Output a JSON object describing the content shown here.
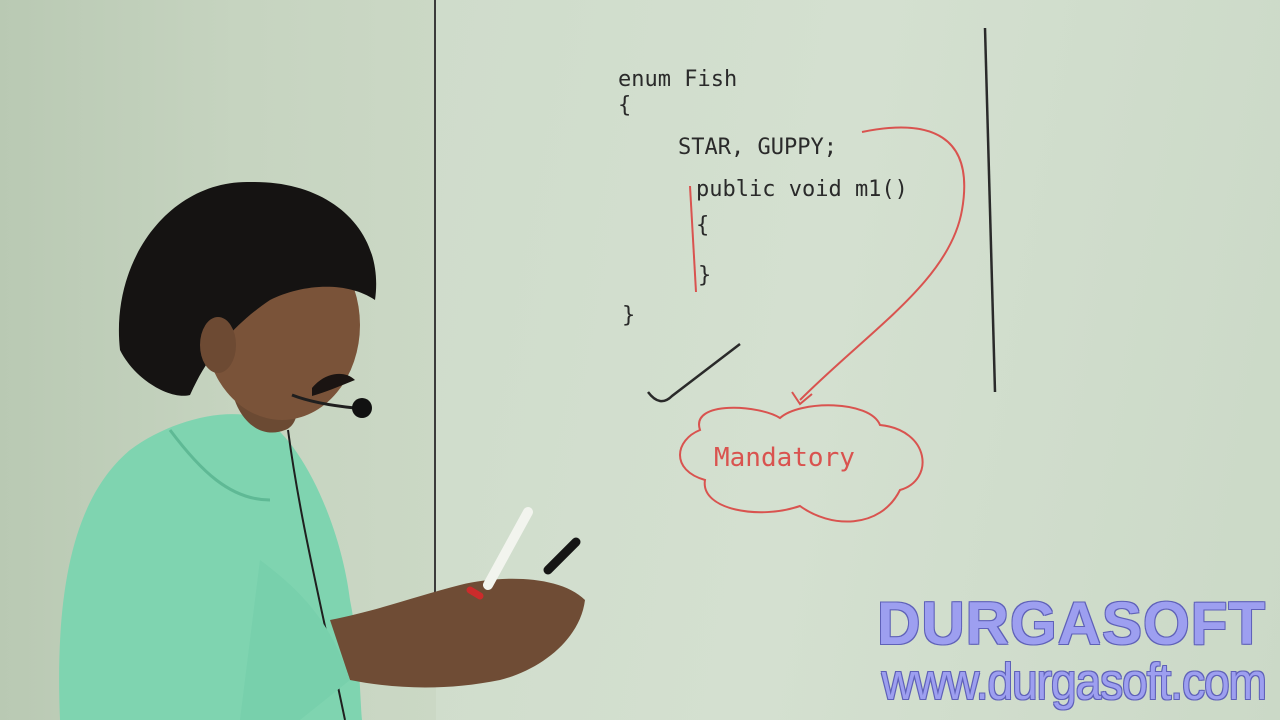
{
  "whiteboard": {
    "code_line_1": "enum Fish",
    "code_open_brace": "{",
    "code_line_2": "STAR, GUPPY;",
    "code_line_3": "public void m1()",
    "code_inner_open": "{",
    "code_inner_close": "}",
    "code_close_brace": "}",
    "annotation": "Mandatory"
  },
  "watermark": {
    "brand": "DURGASOFT",
    "url": "www.durgasoft.com"
  },
  "colors": {
    "ink": "#2a2a2a",
    "red_ink": "#d9534f",
    "shirt": "#7fd4b0",
    "watermark": "#9d9ff0"
  }
}
